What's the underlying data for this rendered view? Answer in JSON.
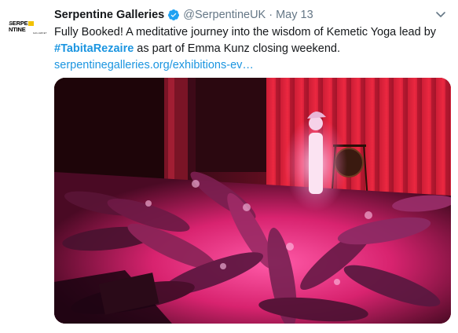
{
  "tweet": {
    "author_name": "Serpentine Galleries",
    "handle": "@SerpentineUK",
    "separator": "·",
    "date": "May 13",
    "text_line1": "Fully Booked! A meditative journey into the wisdom of Kemetic Yoga lead by",
    "hashtag": "#TabitaRezaire",
    "text_line2_rest": " as part of Emma Kunz closing weekend.",
    "link": "serpentinegalleries.org/exhibitions-ev…"
  },
  "avatar": {
    "logo_left": "SERPE",
    "logo_right": "NTINE",
    "logo_sub": "GALLERIES"
  },
  "colors": {
    "link": "#1b95e0",
    "verified": "#1da1f2",
    "muted": "#657786"
  },
  "icons": {
    "verified": "verified-badge-icon",
    "caret": "chevron-down-icon"
  }
}
